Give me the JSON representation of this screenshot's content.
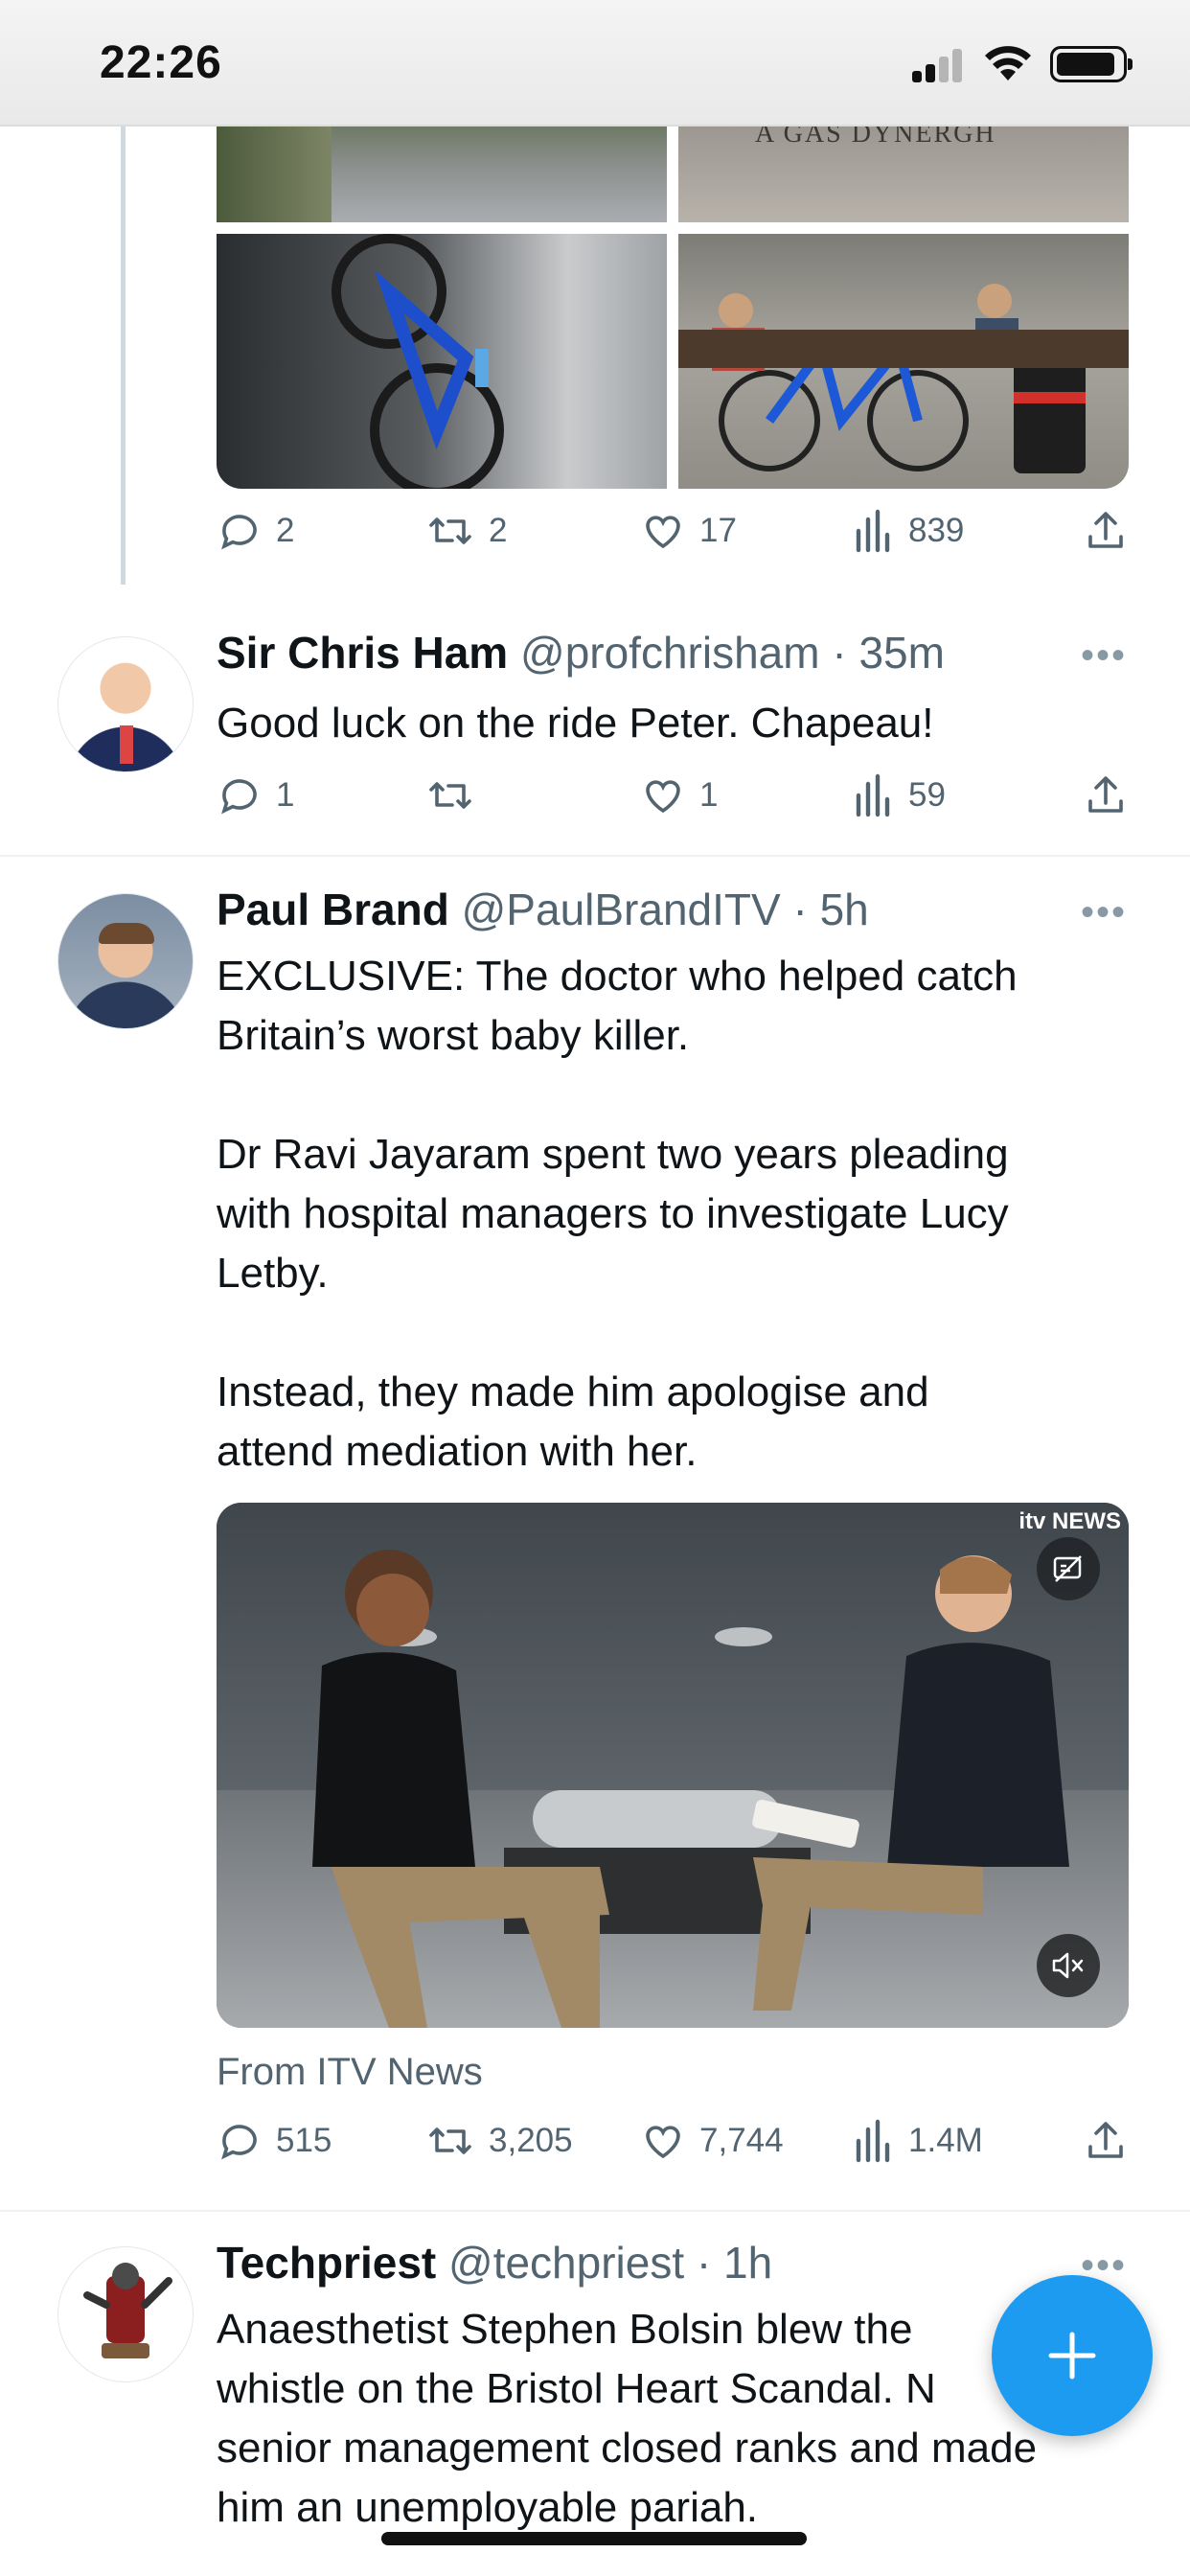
{
  "status_bar": {
    "time": "22:26"
  },
  "tweets": [
    {
      "stats": {
        "replies": "2",
        "retweets": "2",
        "likes": "17",
        "views": "839"
      }
    },
    {
      "name": "Sir Chris Ham",
      "handle": "@profchrisham",
      "time": "· 35m",
      "text": "Good luck on the ride Peter. Chapeau!",
      "stats": {
        "replies": "1",
        "retweets": "",
        "likes": "1",
        "views": "59"
      }
    },
    {
      "name": "Paul Brand",
      "handle": "@PaulBrandITV",
      "time": "· 5h",
      "text_lines": [
        "EXCLUSIVE: The doctor who helped catch",
        "Britain’s worst baby killer.",
        "Dr Ravi Jayaram spent two years pleading",
        "with hospital managers to investigate Lucy",
        "Letby.",
        "Instead, they made him apologise and",
        "attend mediation with her."
      ],
      "video_watermark": "itv NEWS",
      "from": "From ITV News",
      "stats": {
        "replies": "515",
        "retweets": "3,205",
        "likes": "7,744",
        "views": "1.4M"
      }
    },
    {
      "name": "Techpriest",
      "handle": "@techpriest",
      "time": "· 1h",
      "text_lines": [
        "Anaesthetist Stephen Bolsin blew the",
        "whistle on the Bristol Heart Scandal. N",
        "senior management closed ranks and made",
        "him an unemployable pariah."
      ]
    }
  ],
  "media_caption": "A GAS DYNERGH",
  "fab": {
    "icon": "plus-icon"
  },
  "colors": {
    "accent": "#1d9bf0",
    "secondary_text": "#536471",
    "divider": "#eff3f4"
  }
}
